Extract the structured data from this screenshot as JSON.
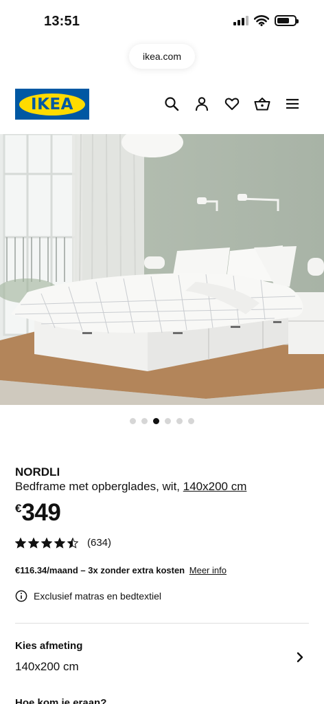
{
  "status_bar": {
    "time": "13:51",
    "battery_level": 0.7
  },
  "browser": {
    "url": "ikea.com"
  },
  "header": {
    "logo_text": "IKEA",
    "brand_colors": {
      "blue": "#0058a3",
      "yellow": "#ffdb00"
    },
    "icons": [
      "search-icon",
      "account-icon",
      "heart-icon",
      "basket-icon",
      "menu-icon"
    ]
  },
  "gallery": {
    "image_count": 6,
    "active_index": 2
  },
  "product": {
    "name": "NORDLI",
    "description": "Bedframe met opberglades, wit,",
    "size_link": "140x200 cm",
    "currency": "€",
    "price": "349",
    "rating_value": 4.5,
    "rating_count": "(634)",
    "finance_text": "€116.34/maand – 3x zonder extra kosten",
    "finance_link": "Meer info",
    "notice": "Exclusief matras en bedtextiel"
  },
  "size_selector": {
    "title": "Kies afmeting",
    "value": "140x200 cm"
  },
  "next_section": {
    "title": "Hoe kom je eraan?"
  }
}
